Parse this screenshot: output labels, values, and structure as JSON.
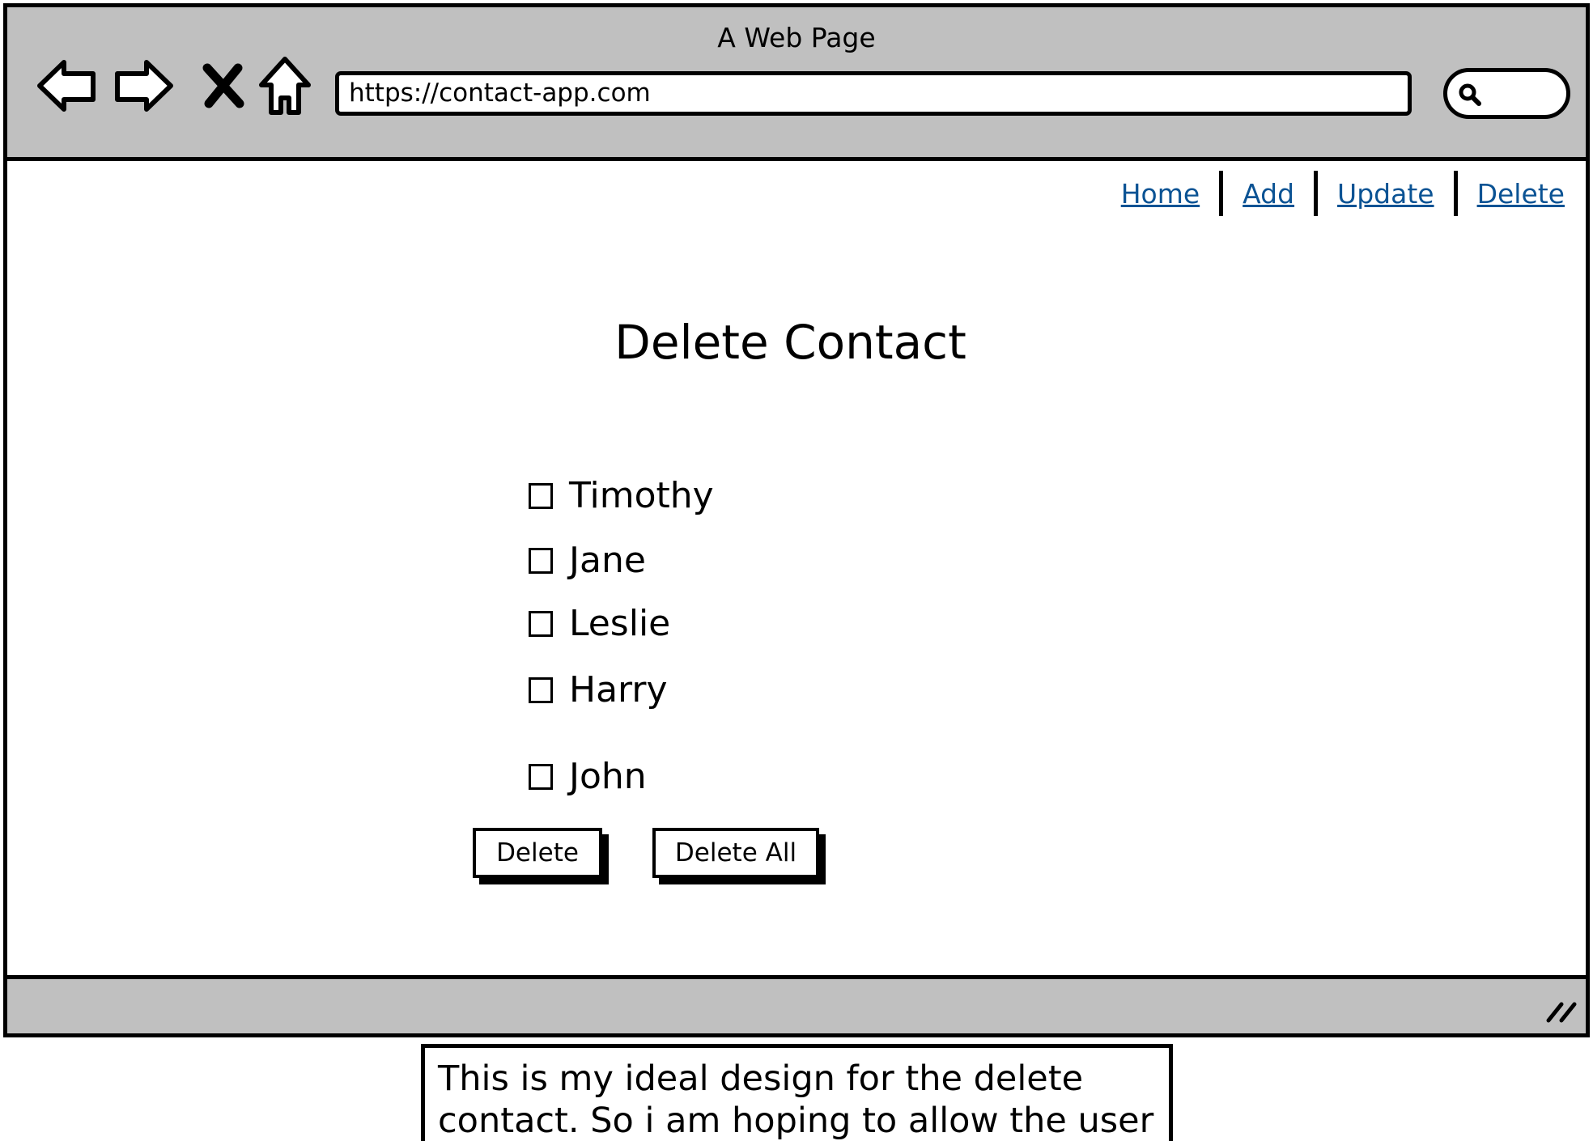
{
  "window": {
    "title": "A Web Page",
    "url": "https://contact-app.com",
    "nav_buttons": [
      "back-icon",
      "forward-icon",
      "stop-icon",
      "home-icon"
    ]
  },
  "nav": {
    "links": [
      "Home",
      "Add",
      "Update",
      "Delete"
    ],
    "link_color": "#0b5394"
  },
  "main": {
    "title": "Delete Contact",
    "contacts": [
      {
        "name": "Timothy",
        "checked": false
      },
      {
        "name": "Jane",
        "checked": false
      },
      {
        "name": "Leslie",
        "checked": false
      },
      {
        "name": "Harry",
        "checked": false
      },
      {
        "name": "John",
        "checked": false
      }
    ],
    "delete_label": "Delete",
    "delete_all_label": "Delete All"
  },
  "note": {
    "text": "This is my ideal design for the delete contact. So i am hoping to allow the user"
  },
  "colors": {
    "chrome": "#c0c0c0",
    "border": "#000000"
  }
}
